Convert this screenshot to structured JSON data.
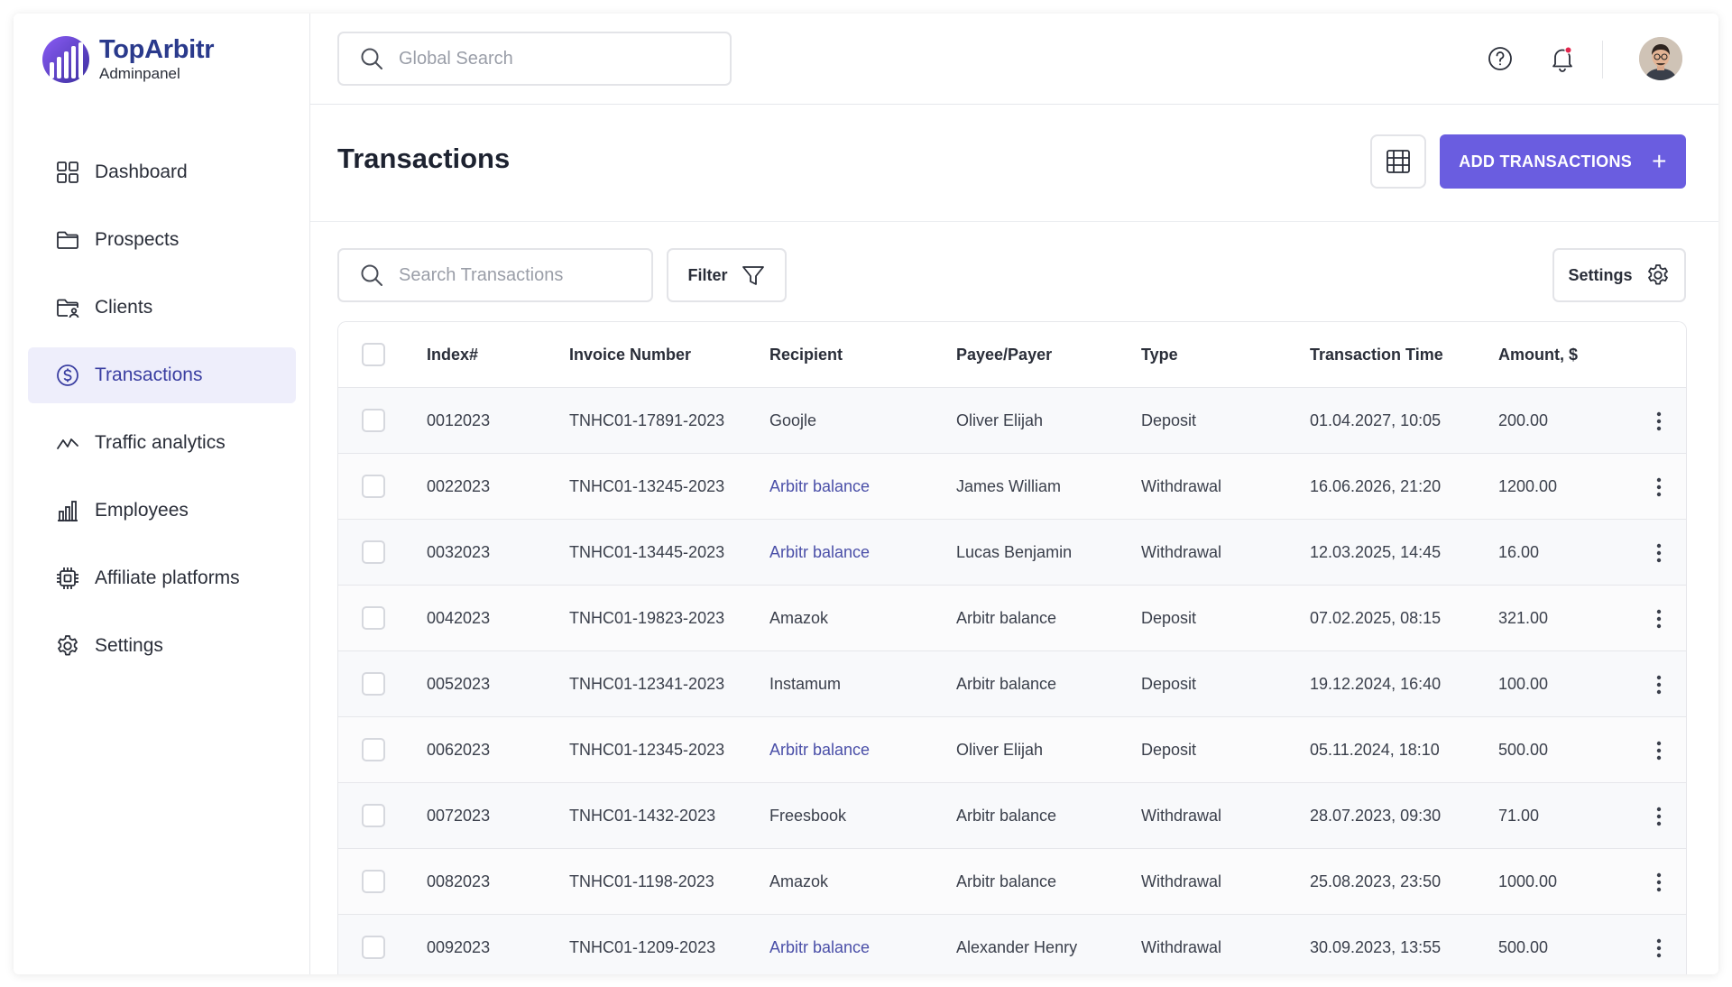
{
  "brand": {
    "title": "TopArbitr",
    "subtitle": "Adminpanel",
    "accent": "#6a5de0"
  },
  "sidebar": {
    "items": [
      {
        "label": "Dashboard",
        "icon": "grid-icon",
        "active": false
      },
      {
        "label": "Prospects",
        "icon": "folder-icon",
        "active": false
      },
      {
        "label": "Clients",
        "icon": "folder-user-icon",
        "active": false
      },
      {
        "label": "Transactions",
        "icon": "dollar-circle-icon",
        "active": true
      },
      {
        "label": "Traffic analytics",
        "icon": "activity-icon",
        "active": false
      },
      {
        "label": "Employees",
        "icon": "bar-chart-icon",
        "active": false
      },
      {
        "label": "Affiliate platforms",
        "icon": "chip-icon",
        "active": false
      },
      {
        "label": "Settings",
        "icon": "gear-icon",
        "active": false
      }
    ]
  },
  "topbar": {
    "search_placeholder": "Global Search"
  },
  "page": {
    "title": "Transactions",
    "add_label": "ADD TRANSACTIONS"
  },
  "toolbar": {
    "search_placeholder": "Search Transactions",
    "filter_label": "Filter",
    "settings_label": "Settings"
  },
  "table": {
    "headers": [
      "Index#",
      "Invoice Number",
      "Recipient",
      "Payee/Payer",
      "Type",
      "Transaction Time",
      "Amount, $"
    ],
    "rows": [
      {
        "index": "0012023",
        "invoice": "TNHC01-17891-2023",
        "recipient": "Goojle",
        "recipient_link": false,
        "payee": "Oliver Elijah",
        "type": "Deposit",
        "time": "01.04.2027, 10:05",
        "amount": "200.00"
      },
      {
        "index": "0022023",
        "invoice": "TNHC01-13245-2023",
        "recipient": "Arbitr balance",
        "recipient_link": true,
        "payee": "James William",
        "type": "Withdrawal",
        "time": "16.06.2026, 21:20",
        "amount": "1200.00"
      },
      {
        "index": "0032023",
        "invoice": "TNHC01-13445-2023",
        "recipient": "Arbitr balance",
        "recipient_link": true,
        "payee": "Lucas Benjamin",
        "type": "Withdrawal",
        "time": "12.03.2025, 14:45",
        "amount": "16.00"
      },
      {
        "index": "0042023",
        "invoice": "TNHC01-19823-2023",
        "recipient": "Amazok",
        "recipient_link": false,
        "payee": "Arbitr balance",
        "type": "Deposit",
        "time": "07.02.2025, 08:15",
        "amount": "321.00"
      },
      {
        "index": "0052023",
        "invoice": "TNHC01-12341-2023",
        "recipient": "Instamum",
        "recipient_link": false,
        "payee": "Arbitr balance",
        "type": "Deposit",
        "time": "19.12.2024, 16:40",
        "amount": "100.00"
      },
      {
        "index": "0062023",
        "invoice": "TNHC01-12345-2023",
        "recipient": "Arbitr balance",
        "recipient_link": true,
        "payee": "Oliver Elijah",
        "type": "Deposit",
        "time": "05.11.2024, 18:10",
        "amount": "500.00"
      },
      {
        "index": "0072023",
        "invoice": "TNHC01-1432-2023",
        "recipient": "Freesbook",
        "recipient_link": false,
        "payee": "Arbitr balance",
        "type": "Withdrawal",
        "time": "28.07.2023, 09:30",
        "amount": "71.00"
      },
      {
        "index": "0082023",
        "invoice": "TNHC01-1198-2023",
        "recipient": "Amazok",
        "recipient_link": false,
        "payee": "Arbitr balance",
        "type": "Withdrawal",
        "time": "25.08.2023, 23:50",
        "amount": "1000.00"
      },
      {
        "index": "0092023",
        "invoice": "TNHC01-1209-2023",
        "recipient": "Arbitr balance",
        "recipient_link": true,
        "payee": "Alexander Henry",
        "type": "Withdrawal",
        "time": "30.09.2023, 13:55",
        "amount": "500.00"
      }
    ]
  }
}
